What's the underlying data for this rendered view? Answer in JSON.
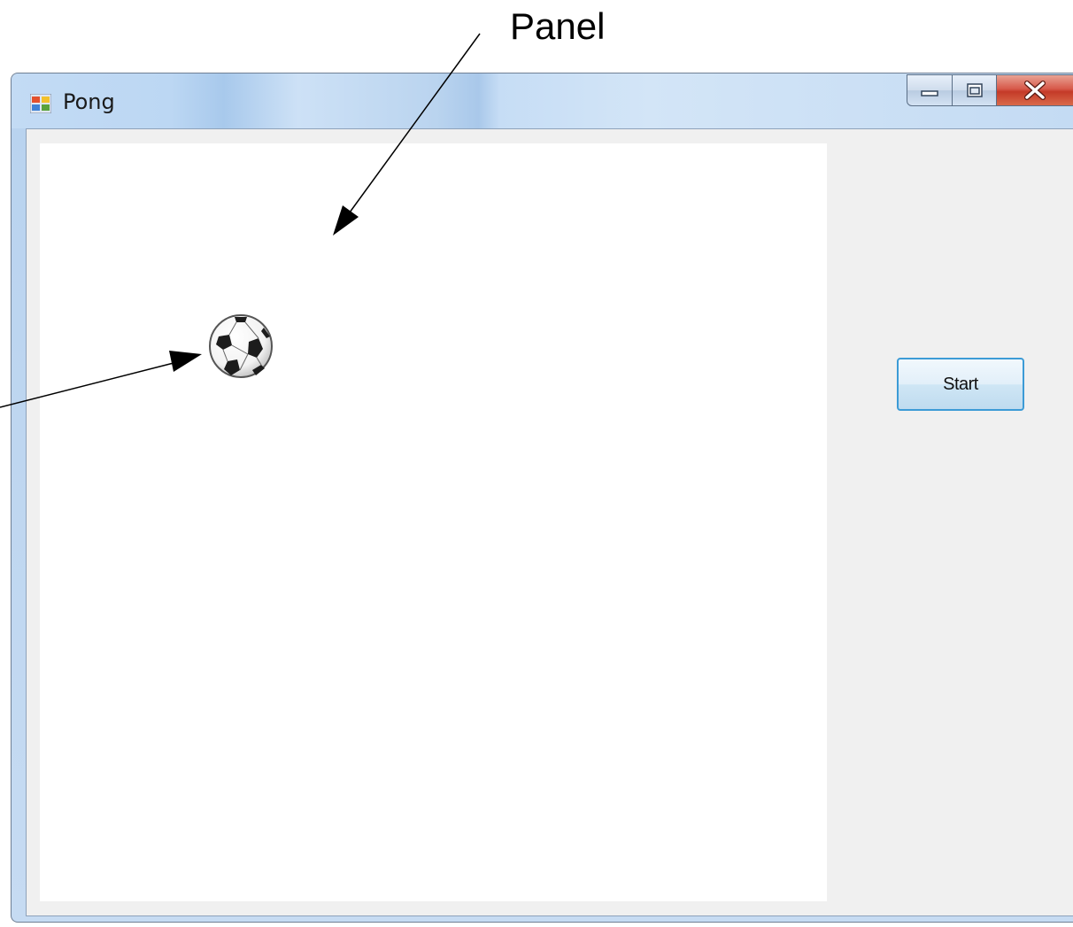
{
  "annotation": {
    "panel_label": "Panel"
  },
  "window": {
    "title": "Pong",
    "icon": "windows-form-icon"
  },
  "caption_buttons": {
    "minimize_icon": "minimize-icon",
    "maximize_icon": "maximize-icon",
    "close_icon": "close-icon"
  },
  "main": {
    "ball_icon": "soccer-ball-icon",
    "start_label": "Start"
  },
  "colors": {
    "start_border": "#3c9bd6",
    "close_button": "#c43a28",
    "panel": "#ffffff",
    "client": "#f0f0f0"
  }
}
